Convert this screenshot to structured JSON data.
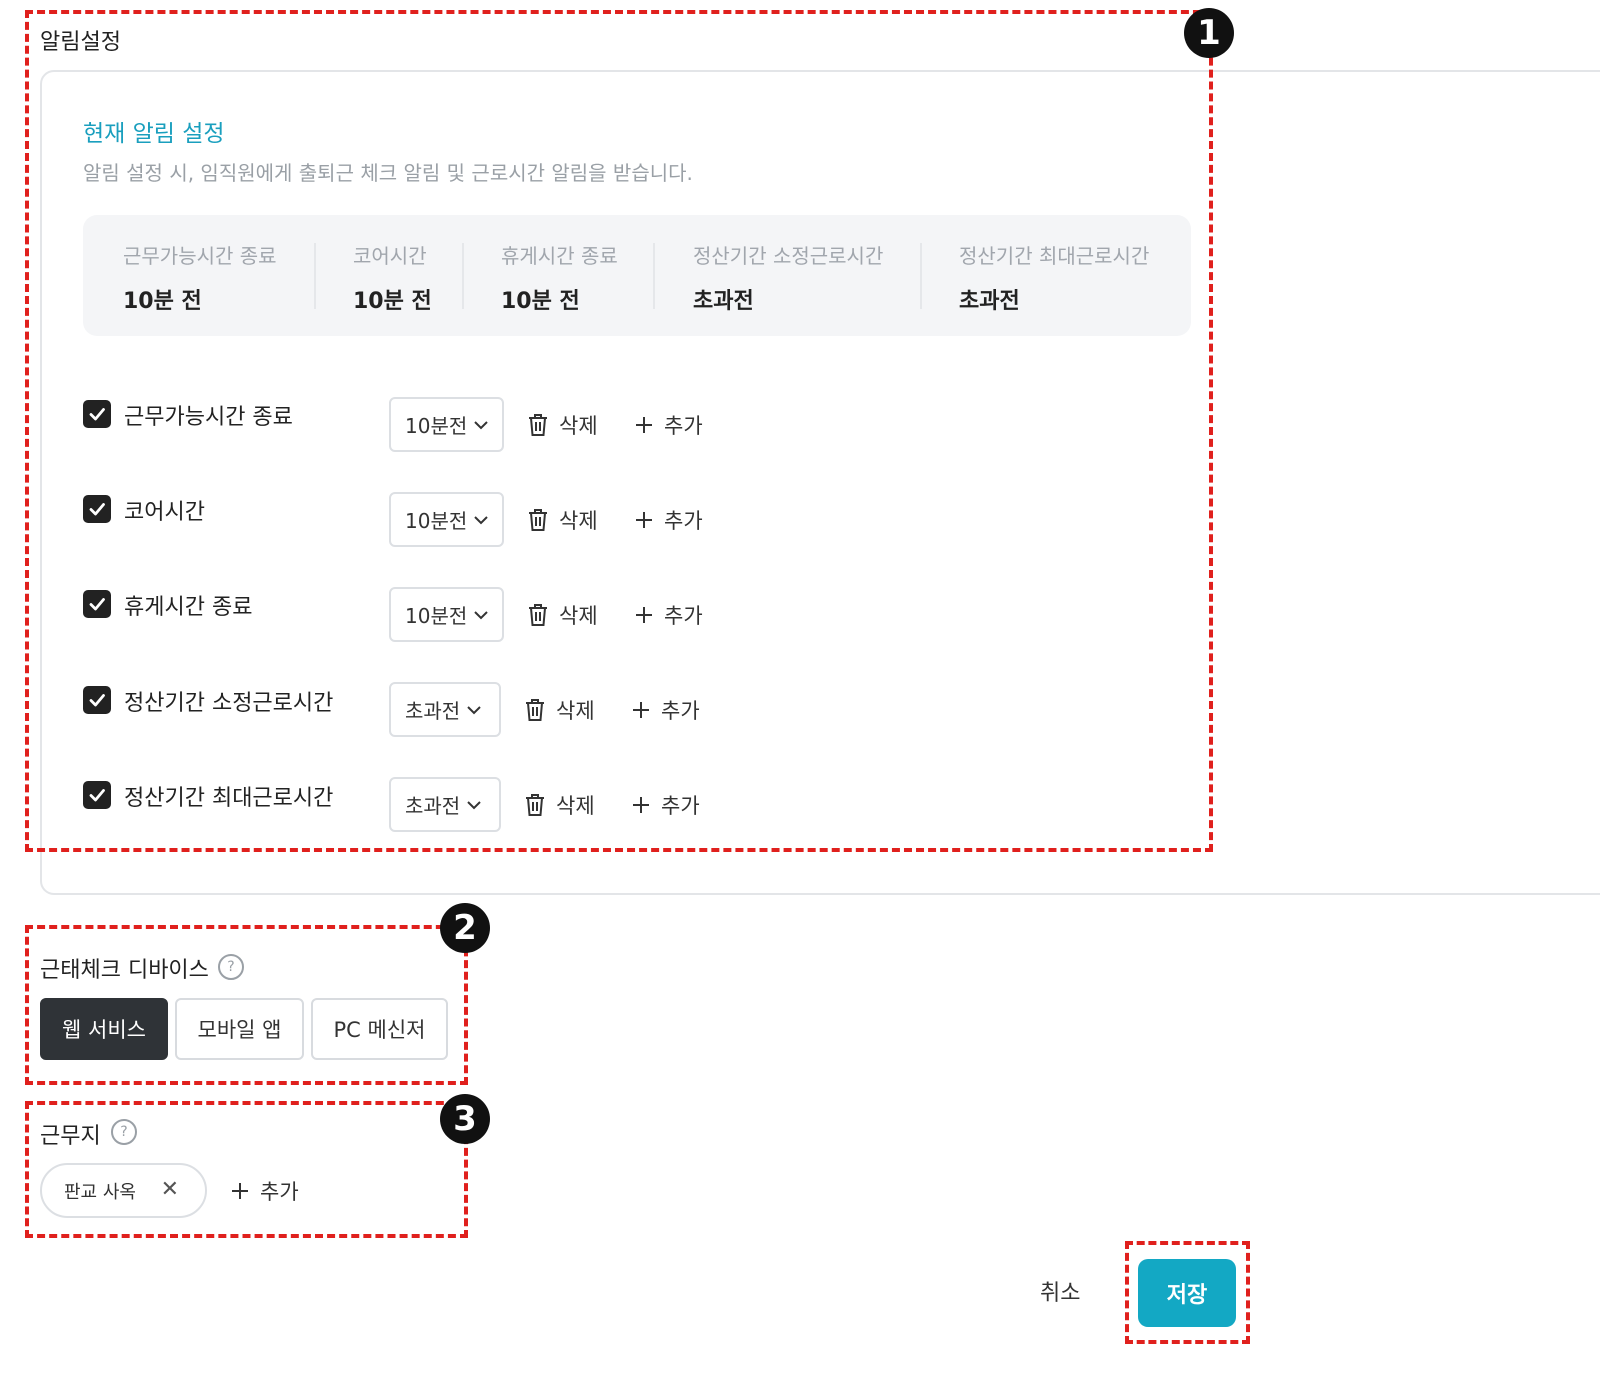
{
  "notification": {
    "section_title": "알림설정",
    "current_title": "현재 알림 설정",
    "description": "알림 설정 시, 임직원에게 출퇴근 체크 알림 및 근로시간 알림을 받습니다.",
    "summary": [
      {
        "label": "근무가능시간 종료",
        "value": "10분 전"
      },
      {
        "label": "코어시간",
        "value": "10분 전"
      },
      {
        "label": "휴게시간 종료",
        "value": "10분 전"
      },
      {
        "label": "정산기간 소정근로시간",
        "value": "초과전"
      },
      {
        "label": "정산기간 최대근로시간",
        "value": "초과전"
      }
    ],
    "rows": [
      {
        "label": "근무가능시간 종료",
        "checked": true,
        "select": "10분전",
        "delete": "삭제",
        "add": "추가"
      },
      {
        "label": "코어시간",
        "checked": true,
        "select": "10분전",
        "delete": "삭제",
        "add": "추가"
      },
      {
        "label": "휴게시간 종료",
        "checked": true,
        "select": "10분전",
        "delete": "삭제",
        "add": "추가"
      },
      {
        "label": "정산기간 소정근로시간",
        "checked": true,
        "select": "초과전",
        "delete": "삭제",
        "add": "추가"
      },
      {
        "label": "정산기간 최대근로시간",
        "checked": true,
        "select": "초과전",
        "delete": "삭제",
        "add": "추가"
      }
    ]
  },
  "device": {
    "title": "근태체크 디바이스",
    "help_icon": "question-circle-icon",
    "options": [
      "웹 서비스",
      "모바일 앱",
      "PC 메신저"
    ],
    "selected": "웹 서비스"
  },
  "workplace": {
    "title": "근무지",
    "help_icon": "question-circle-icon",
    "chip": "판교 사옥",
    "add": "추가"
  },
  "footer": {
    "cancel": "취소",
    "save": "저장"
  },
  "markers": [
    "1",
    "2",
    "3"
  ],
  "colors": {
    "accent": "#13a8c4",
    "title_accent": "#1a9fbe",
    "annotation": "#e0201d",
    "active_segment": "#2f3337"
  }
}
